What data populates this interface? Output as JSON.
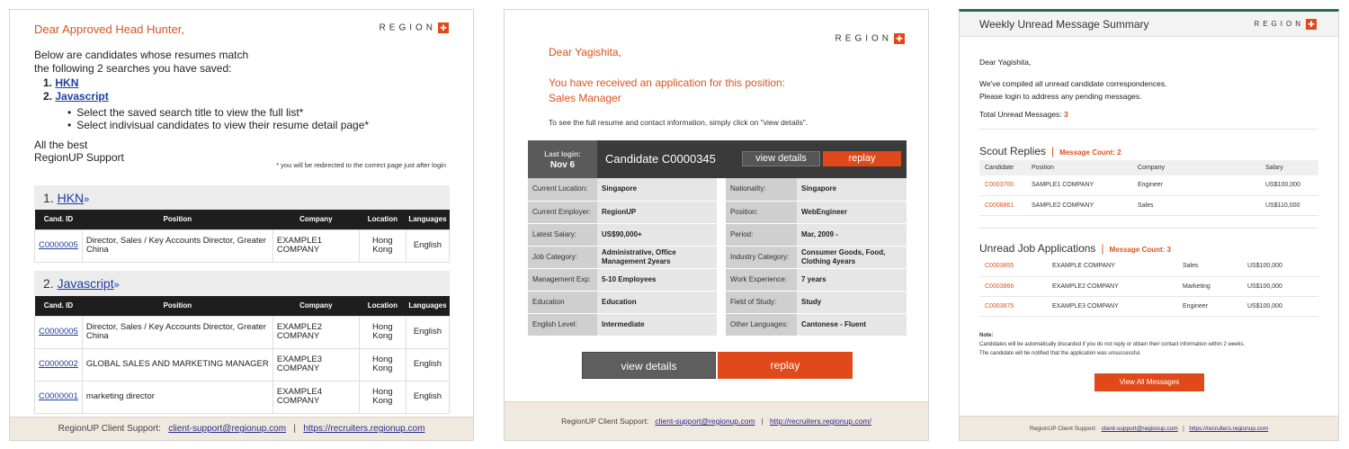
{
  "logo": {
    "text": "REGION",
    "mark": "✚"
  },
  "email1": {
    "greeting": "Dear Approved Head Hunter,",
    "intro_line1": "Below are candidates whose resumes match",
    "intro_line2": "the following 2 searches you have saved:",
    "searches": [
      {
        "num": "1.",
        "name": "HKN"
      },
      {
        "num": "2.",
        "name": "Javascript"
      }
    ],
    "tips": [
      "Select the saved search title to view the full list*",
      "Select indivisual candidates to view their resume detail page*"
    ],
    "signoff1": "All the best",
    "signoff2": "RegionUP Support",
    "note": "* you will be redirected to the correct page just after login",
    "sections": [
      {
        "num": "1.",
        "name": "HKN",
        "chevron": "»"
      },
      {
        "num": "2.",
        "name": "Javascript",
        "chevron": "»"
      }
    ],
    "table_headers": [
      "Cand. ID",
      "Position",
      "Company",
      "Location",
      "Languages"
    ],
    "table1_rows": [
      {
        "id": "C0000005",
        "position": "Director, Sales / Key Accounts Director, Greater China",
        "company": "EXAMPLE1 COMPANY",
        "location": "Hong Kong",
        "language": "English"
      }
    ],
    "table2_rows": [
      {
        "id": "C0000005",
        "position": "Director, Sales / Key Accounts Director, Greater China",
        "company": "EXAMPLE2 COMPANY",
        "location": "Hong Kong",
        "language": "English"
      },
      {
        "id": "C0000002",
        "position": "GLOBAL SALES AND MARKETING MANAGER",
        "company": "EXAMPLE3 COMPANY",
        "location": "Hong Kong",
        "language": "English"
      },
      {
        "id": "C0000001",
        "position": "marketing director",
        "company": "EXAMPLE4 COMPANY",
        "location": "Hong Kong",
        "language": "English"
      }
    ],
    "footer_label": "RegionUP Client Support:",
    "footer_email": "client-support@regionup.com",
    "footer_sep": "|",
    "footer_url": "https://recruiters.regionup.com"
  },
  "email2": {
    "greeting": "Dear Yagishita,",
    "msg_line1": "You have received an application for this position:",
    "msg_line2": "Sales Manager",
    "hint": "To see the full resume and contact information, simply click on \"view details\".",
    "last_login_label": "Last login:",
    "last_login_date": "Nov 6",
    "candidate_title": "Candidate C0000345",
    "view_details": "view details",
    "replay_small": "replay",
    "rows": [
      {
        "l1": "Current Location:",
        "v1": "Singapore",
        "l2": "Nationality:",
        "v2": "Singapore"
      },
      {
        "l1": "Current Employer:",
        "v1": "RegionUP",
        "l2": "Position:",
        "v2": "WebEngineer"
      },
      {
        "l1": "Latest Salary:",
        "v1": "US$90,000+",
        "l2": "Period:",
        "v2": "Mar, 2009 -"
      },
      {
        "l1": "Job Category:",
        "v1": "Administrative, Office Management 2years",
        "l2": "Industry Category:",
        "v2": "Consumer Goods, Food, Clothing 4years"
      },
      {
        "l1": "Management Exp:",
        "v1": "5-10 Employees",
        "l2": "Work Experience:",
        "v2": "7   years"
      },
      {
        "l1": "Education",
        "v1": "Education",
        "l2": "Field of Study:",
        "v2": "Study"
      },
      {
        "l1": "English Level:",
        "v1": "Intermediate",
        "l2": "Other Languages:",
        "v2": "Cantonese - Fluent"
      }
    ],
    "btn_view": "view details",
    "btn_replay": "replay",
    "footer_label": "RegionUP Client Support:",
    "footer_email": "client-support@regionup.com",
    "footer_sep": "|",
    "footer_url": "http://recruiters.regionup.com/"
  },
  "email3": {
    "title": "Weekly Unread Message Summary",
    "greeting": "Dear Yagishita,",
    "line1": "We've compiled all unread candidate correspondences.",
    "line2": "Please login to address any pending messages.",
    "total_label": "Total Unread Messages:",
    "total_value": "3",
    "scout_title": "Scout Replies",
    "scout_count": "Message Count: 2",
    "scout_headers": [
      "Candidate",
      "Position",
      "Company",
      "Salary"
    ],
    "scout_rows": [
      {
        "id": "C0003700",
        "position": "SAMPLE1 COMPANY",
        "company": "Engineer",
        "salary": "US$100,000"
      },
      {
        "id": "C0008861",
        "position": "SAMPLE2 COMPANY",
        "company": "Sales",
        "salary": "US$110,000"
      }
    ],
    "apps_title": "Unread Job Applications",
    "apps_count": "Message Count: 3",
    "apps_rows": [
      {
        "id": "C0003855",
        "company": "EXAMPLE COMPANY",
        "role": "Sales",
        "salary": "US$100,000"
      },
      {
        "id": "C0003866",
        "company": "EXAMPLE2 COMPANY",
        "role": "Marketing",
        "salary": "US$100,000"
      },
      {
        "id": "C0003875",
        "company": "EXAMPLE3 COMPANY",
        "role": "Engineer",
        "salary": "US$100,000"
      }
    ],
    "note_title": "Note:",
    "note1": "Candidates will be automatically discarded if you do not reply or obtain their contact information within 2 weeks.",
    "note2": "The candidate will be notified that the application was unsuccessful.",
    "btn_all": "View All Messages",
    "footer_label": "RegionUP Client Support:",
    "footer_email": "client-support@regionup.com",
    "footer_sep": "|",
    "footer_url": "https://recruiters.regionup.com"
  },
  "colors": {
    "accent": "#e04a1a",
    "dark": "#1e1e1e",
    "link": "#1f3fa0"
  }
}
